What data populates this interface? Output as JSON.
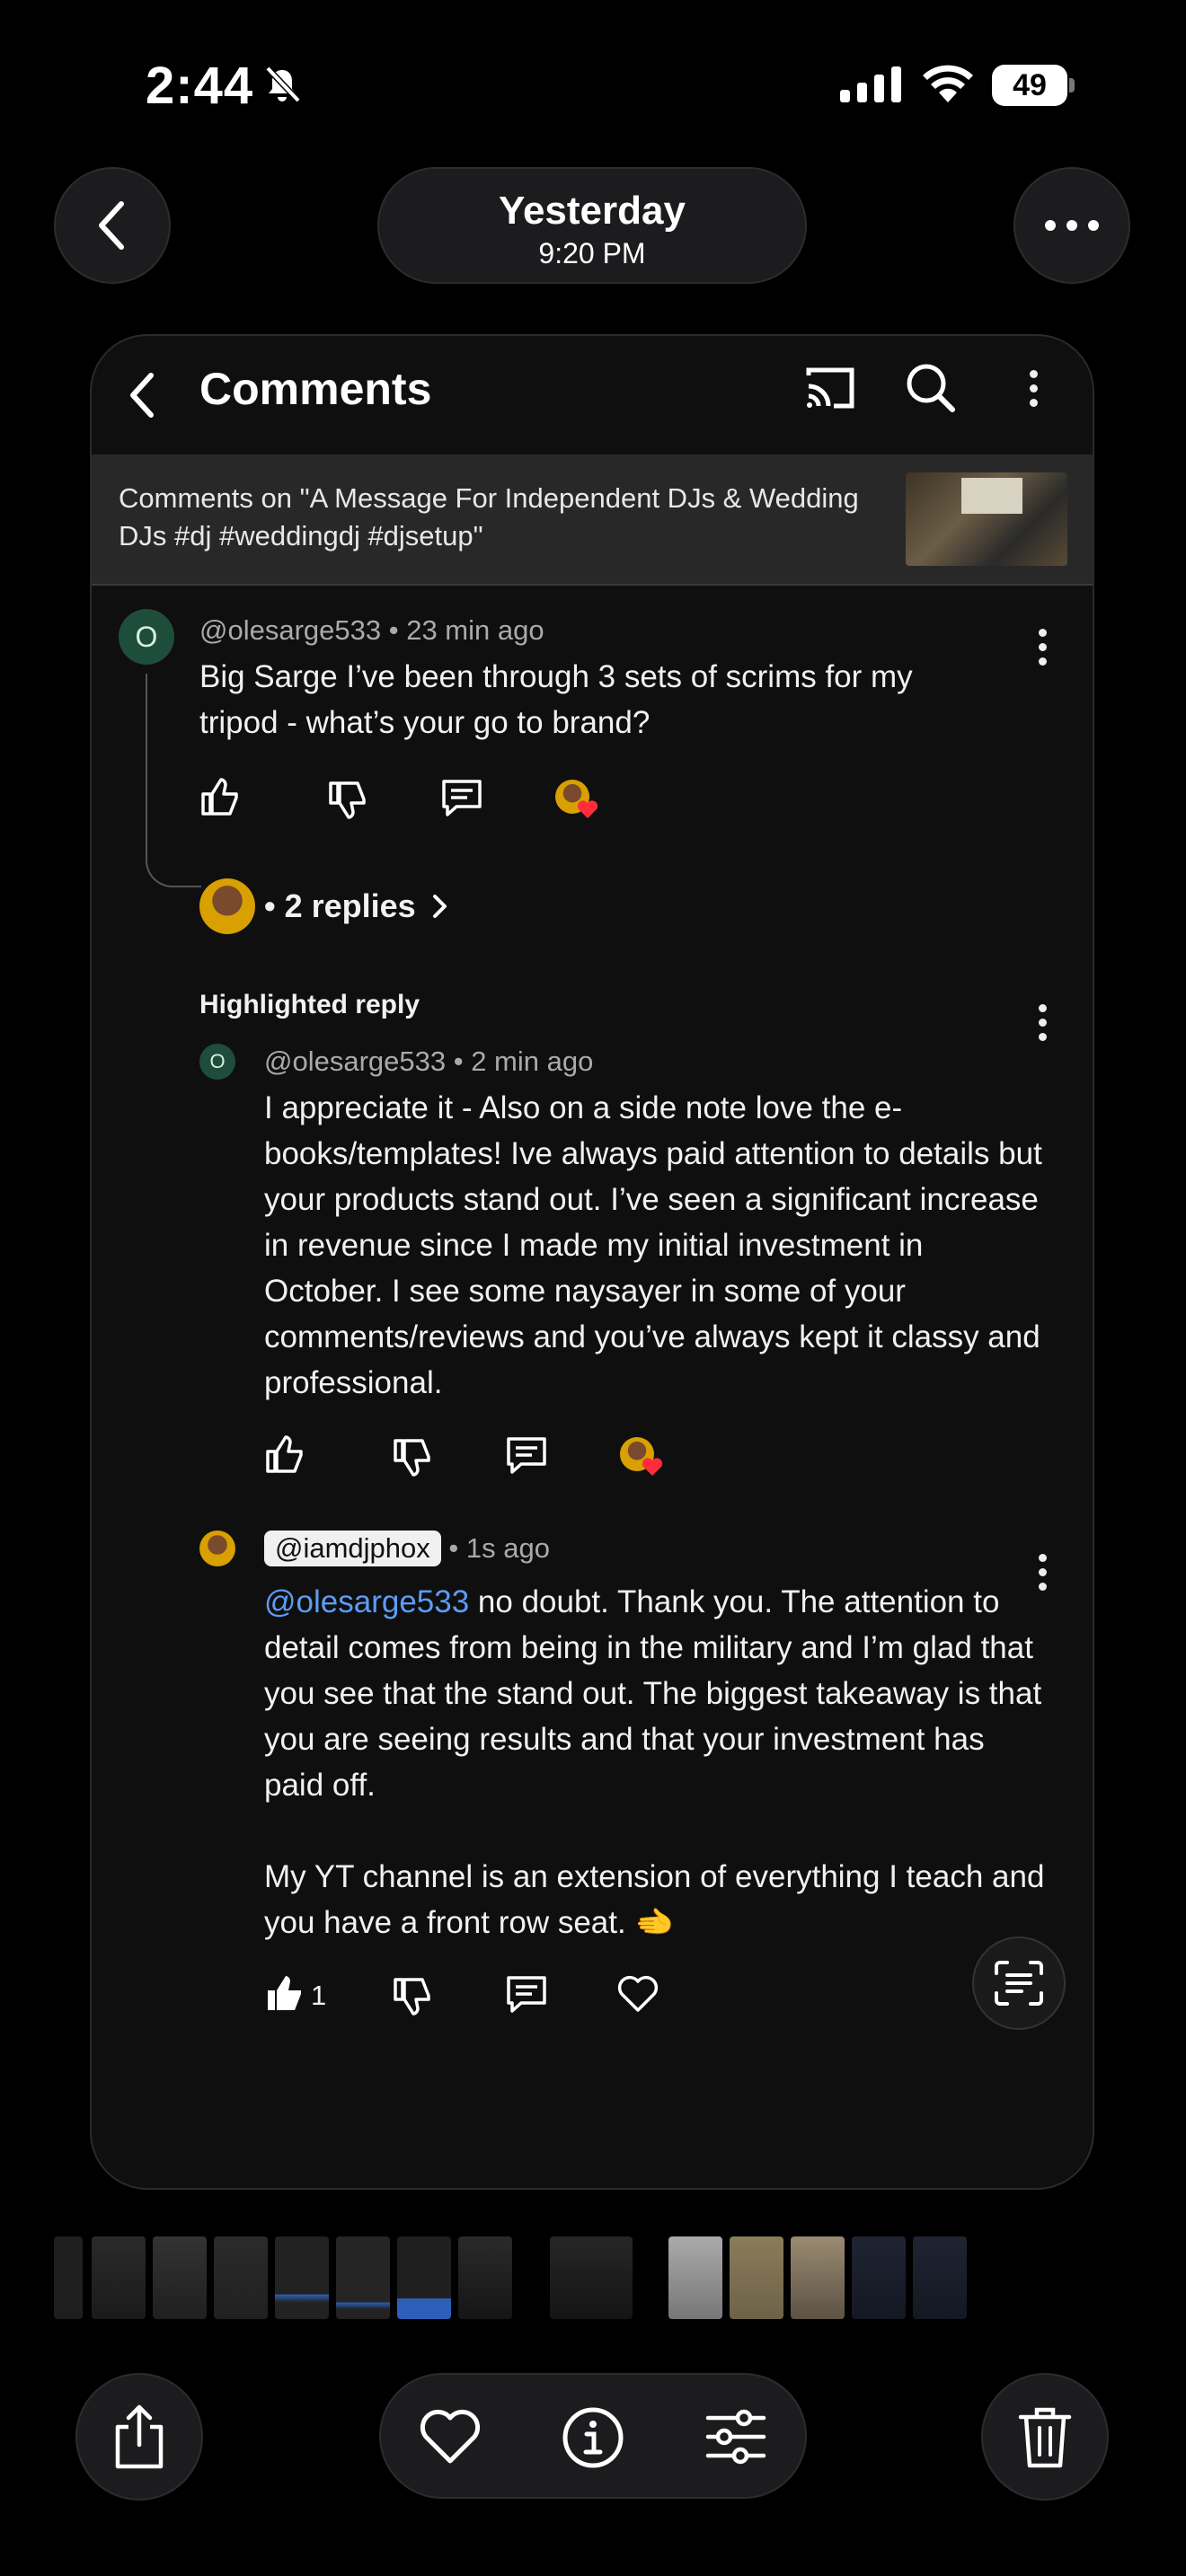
{
  "status_bar": {
    "time": "2:44",
    "battery": "49"
  },
  "top_nav": {
    "date": "Yesterday",
    "time": "9:20 PM"
  },
  "screenshot": {
    "header": {
      "title": "Comments"
    },
    "video": {
      "caption": "Comments on \"A Message For Independent DJs & Wedding DJs #dj #weddingdj #djsetup\""
    },
    "comment": {
      "avatar_letter": "O",
      "author": "@olesarge533",
      "age": "23 min ago",
      "text": "Big Sarge I’ve been through 3 sets of scrims for my tripod - what’s your go to brand?",
      "replies_label": "• 2 replies"
    },
    "highlighted_label": "Highlighted reply",
    "reply1": {
      "avatar_letter": "O",
      "author": "@olesarge533",
      "age": "2 min ago",
      "text": "I appreciate it - Also on a side note love the e-books/templates! Ive always paid attention to details but your products stand out. I’ve seen a significant increase in revenue since I made my initial investment in October. I see some naysayer in some of your comments/reviews and you’ve always kept it classy and professional."
    },
    "reply2": {
      "author": "@iamdjphox",
      "age": "1s ago",
      "mention": "@olesarge533",
      "text1": " no doubt. Thank you. The attention to detail comes from being in the military and I’m glad that you see that the stand out. The biggest takeaway is that you are seeing results and that your investment has paid off.",
      "text2": "My YT channel is an extension of everything I teach and you have a front row seat. 🫲",
      "like_count": "1"
    }
  },
  "icons": [
    "chevron-left-icon",
    "more-icon",
    "cast-icon",
    "search-icon",
    "thumb-up-icon",
    "thumb-down-icon",
    "reply-icon",
    "heart-icon",
    "share-icon",
    "info-icon",
    "sliders-icon",
    "trash-icon",
    "live-text-icon"
  ]
}
